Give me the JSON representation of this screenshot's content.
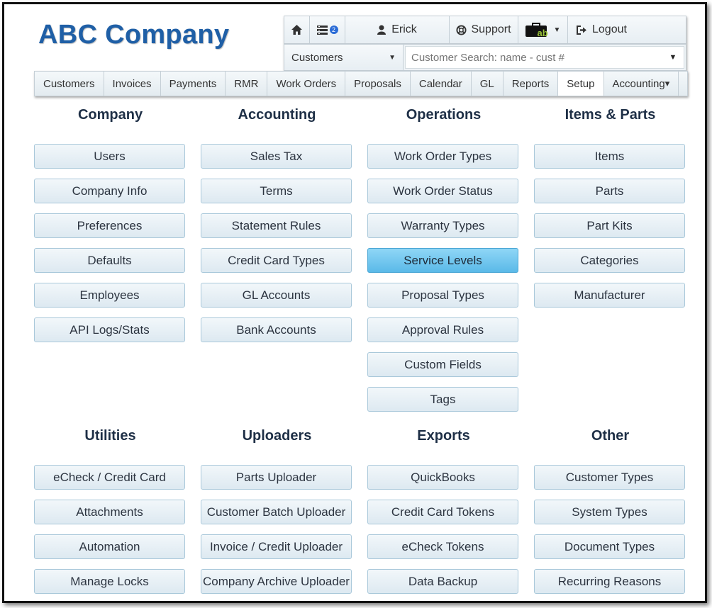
{
  "brand": {
    "logo_text": "ABC Company"
  },
  "topbar": {
    "notification_count": "2",
    "user": "Erick",
    "support": "Support",
    "logout": "Logout",
    "app_icon_text": "ab"
  },
  "search": {
    "scope": "Customers",
    "placeholder": "Customer Search: name - cust #"
  },
  "nav": {
    "tabs": [
      "Customers",
      "Invoices",
      "Payments",
      "RMR",
      "Work Orders",
      "Proposals",
      "Calendar",
      "GL",
      "Reports",
      "Setup",
      "Accounting"
    ],
    "active": "Setup"
  },
  "sections": {
    "company": {
      "title": "Company",
      "items": [
        "Users",
        "Company Info",
        "Preferences",
        "Defaults",
        "Employees",
        "API Logs/Stats"
      ]
    },
    "accounting": {
      "title": "Accounting",
      "items": [
        "Sales Tax",
        "Terms",
        "Statement Rules",
        "Credit Card Types",
        "GL Accounts",
        "Bank Accounts"
      ]
    },
    "operations": {
      "title": "Operations",
      "items": [
        "Work Order Types",
        "Work Order Status",
        "Warranty Types",
        "Service Levels",
        "Proposal Types",
        "Approval Rules",
        "Custom Fields",
        "Tags"
      ],
      "active": "Service Levels"
    },
    "items_parts": {
      "title": "Items & Parts",
      "items": [
        "Items",
        "Parts",
        "Part Kits",
        "Categories",
        "Manufacturer"
      ]
    },
    "utilities": {
      "title": "Utilities",
      "items": [
        "eCheck / Credit Card",
        "Attachments",
        "Automation",
        "Manage Locks"
      ]
    },
    "uploaders": {
      "title": "Uploaders",
      "items": [
        "Parts Uploader",
        "Customer Batch Uploader",
        "Invoice / Credit Uploader",
        "Company Archive Uploader"
      ]
    },
    "exports": {
      "title": "Exports",
      "items": [
        "QuickBooks",
        "Credit Card Tokens",
        "eCheck Tokens",
        "Data Backup"
      ]
    },
    "other": {
      "title": "Other",
      "items": [
        "Customer Types",
        "System Types",
        "Document Types",
        "Recurring Reasons"
      ]
    }
  },
  "colors": {
    "logo": "#1f5fa6",
    "active_button": "#5ab9e8",
    "button_border": "#a9c8da",
    "section_title": "#1e2f46"
  }
}
